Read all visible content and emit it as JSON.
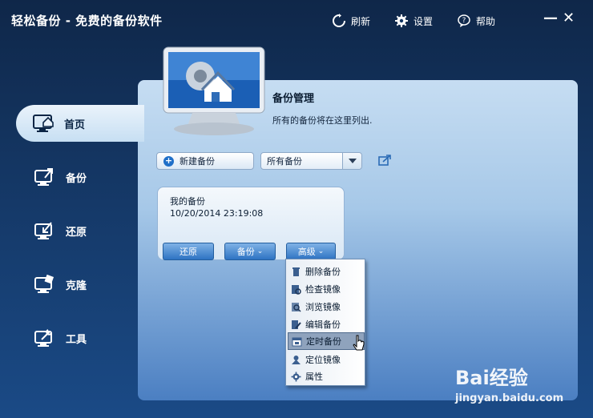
{
  "window": {
    "title": "轻松备份 - 免费的备份软件"
  },
  "toolbar": {
    "refresh_label": "刷新",
    "settings_label": "设置",
    "help_label": "帮助"
  },
  "sidebar": {
    "items": [
      {
        "label": "首页",
        "icon": "home-monitor-icon",
        "active": true
      },
      {
        "label": "备份",
        "icon": "backup-monitor-icon",
        "active": false
      },
      {
        "label": "还原",
        "icon": "restore-monitor-icon",
        "active": false
      },
      {
        "label": "克隆",
        "icon": "clone-monitor-icon",
        "active": false
      },
      {
        "label": "工具",
        "icon": "tools-monitor-icon",
        "active": false
      }
    ]
  },
  "panel": {
    "title": "备份管理",
    "description": "所有的备份将在这里列出."
  },
  "actions": {
    "new_backup_label": "新建备份",
    "filter_selected": "所有备份"
  },
  "backup_card": {
    "name": "我的备份",
    "timestamp": "10/20/2014 23:19:08",
    "restore_label": "还原",
    "backup_label": "备份",
    "advanced_label": "高级"
  },
  "context_menu": {
    "items": [
      {
        "label": "删除备份",
        "icon": "trash-icon"
      },
      {
        "label": "检查镜像",
        "icon": "check-image-icon"
      },
      {
        "label": "浏览镜像",
        "icon": "browse-image-icon"
      },
      {
        "label": "编辑备份",
        "icon": "edit-backup-icon"
      },
      {
        "label": "定时备份",
        "icon": "schedule-icon",
        "highlighted": true
      },
      {
        "label": "定位镜像",
        "icon": "locate-image-icon"
      },
      {
        "label": "属性",
        "icon": "properties-icon"
      }
    ]
  },
  "watermark": {
    "brand": "Bai经验",
    "url": "jingyan.baidu.com"
  },
  "colors": {
    "accent": "#2e73c3",
    "panel": "#a6c8e8",
    "highlight": "#8fa3bd"
  }
}
